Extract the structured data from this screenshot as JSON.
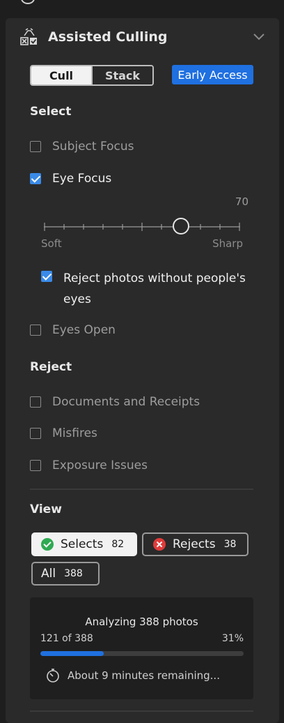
{
  "panel": {
    "title": "Assisted Culling",
    "icon": "assisted-culling-icon",
    "collapse_icon": "chevron-down-icon"
  },
  "mode": {
    "options": [
      "Cull",
      "Stack"
    ],
    "active": "Cull",
    "badge": "Early Access"
  },
  "select_section": {
    "title": "Select",
    "subject_focus": {
      "label": "Subject Focus",
      "checked": false
    },
    "eye_focus": {
      "label": "Eye Focus",
      "checked": true
    },
    "slider": {
      "value": "70",
      "min_label": "Soft",
      "max_label": "Sharp",
      "level_fraction": 0.7
    },
    "reject_without_eyes": {
      "label": "Reject photos without people's eyes",
      "checked": true
    },
    "eyes_open": {
      "label": "Eyes Open",
      "checked": false
    }
  },
  "reject_section": {
    "title": "Reject",
    "documents": {
      "label": "Documents and Receipts",
      "checked": false
    },
    "misfires": {
      "label": "Misfires",
      "checked": false
    },
    "exposure": {
      "label": "Exposure Issues",
      "checked": false
    }
  },
  "view_section": {
    "title": "View",
    "selects": {
      "label": "Selects",
      "count": "82"
    },
    "rejects": {
      "label": "Rejects",
      "count": "38"
    },
    "all": {
      "label": "All",
      "count": "388"
    }
  },
  "analysis": {
    "title": "Analyzing 388 photos",
    "progress_count": "121 of 388",
    "progress_percent": "31%",
    "progress_fraction": 0.31,
    "remaining": "About 9 minutes remaining...",
    "colors": {
      "accent": "#1f70e0",
      "select": "#2faa52",
      "reject": "#e03b3b"
    }
  }
}
